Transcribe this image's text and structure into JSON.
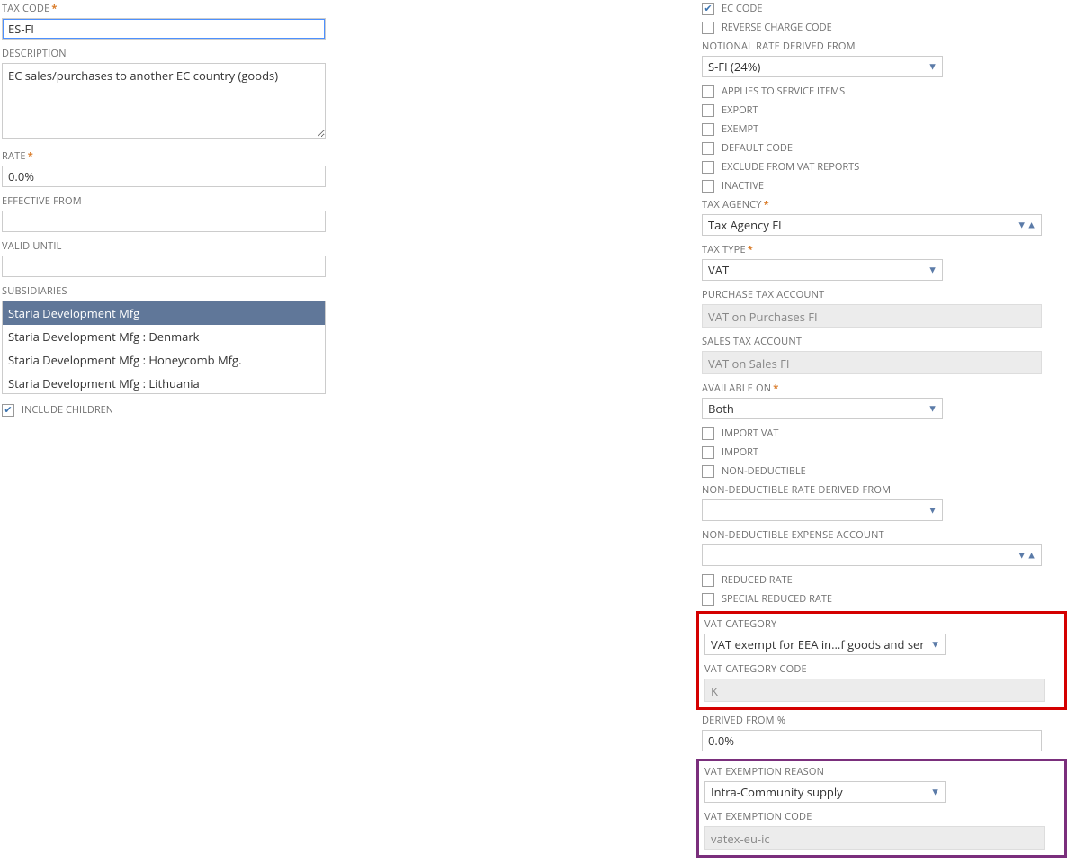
{
  "left": {
    "tax_code_label": "TAX CODE",
    "tax_code_value": "ES-FI",
    "description_label": "DESCRIPTION",
    "description_value": "EC sales/purchases to another EC country (goods)",
    "rate_label": "RATE",
    "rate_value": "0.0%",
    "effective_from_label": "EFFECTIVE FROM",
    "effective_from_value": "",
    "valid_until_label": "VALID UNTIL",
    "valid_until_value": "",
    "subsidiaries_label": "SUBSIDIARIES",
    "subsidiaries": [
      "Staria Development Mfg",
      "Staria Development Mfg : Denmark",
      "Staria Development Mfg : Honeycomb Mfg.",
      "Staria Development Mfg : Lithuania"
    ],
    "include_children_label": "INCLUDE CHILDREN"
  },
  "right": {
    "ec_code_label": "EC CODE",
    "reverse_charge_label": "REVERSE CHARGE CODE",
    "notional_rate_label": "NOTIONAL RATE DERIVED FROM",
    "notional_rate_value": "S-FI (24%)",
    "applies_service_label": "APPLIES TO SERVICE ITEMS",
    "export_label": "EXPORT",
    "exempt_label": "EXEMPT",
    "default_code_label": "DEFAULT CODE",
    "exclude_vat_label": "EXCLUDE FROM VAT REPORTS",
    "inactive_label": "INACTIVE",
    "tax_agency_label": "TAX AGENCY",
    "tax_agency_value": "Tax Agency FI",
    "tax_type_label": "TAX TYPE",
    "tax_type_value": "VAT",
    "purchase_tax_account_label": "PURCHASE TAX ACCOUNT",
    "purchase_tax_account_value": "VAT on Purchases FI",
    "sales_tax_account_label": "SALES TAX ACCOUNT",
    "sales_tax_account_value": "VAT on Sales FI",
    "available_on_label": "AVAILABLE ON",
    "available_on_value": "Both",
    "import_vat_label": "IMPORT VAT",
    "import_label": "IMPORT",
    "non_deductible_label": "NON-DEDUCTIBLE",
    "nd_rate_from_label": "NON-DEDUCTIBLE RATE DERIVED FROM",
    "nd_rate_from_value": "",
    "nd_expense_account_label": "NON-DEDUCTIBLE EXPENSE ACCOUNT",
    "nd_expense_account_value": "",
    "reduced_rate_label": "REDUCED RATE",
    "special_reduced_label": "SPECIAL REDUCED RATE",
    "vat_category_label": "VAT CATEGORY",
    "vat_category_value": "VAT exempt for EEA in...f goods and services",
    "vat_category_code_label": "VAT CATEGORY CODE",
    "vat_category_code_value": "K",
    "derived_from_pct_label": "DERIVED FROM %",
    "derived_from_pct_value": "0.0%",
    "vat_exemption_reason_label": "VAT EXEMPTION REASON",
    "vat_exemption_reason_value": "Intra-Community supply",
    "vat_exemption_code_label": "VAT EXEMPTION CODE",
    "vat_exemption_code_value": "vatex-eu-ic"
  }
}
